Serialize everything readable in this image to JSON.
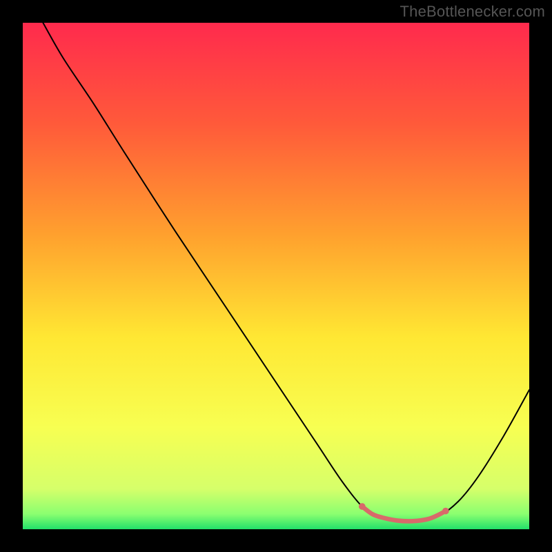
{
  "attribution": "TheBottlenecker.com",
  "chart_data": {
    "type": "line",
    "title": "",
    "xlabel": "",
    "ylabel": "",
    "xlim": [
      0,
      100
    ],
    "ylim": [
      0,
      100
    ],
    "gradient_stops": [
      {
        "offset": 0,
        "color": "#ff2a4d"
      },
      {
        "offset": 20,
        "color": "#ff5a3a"
      },
      {
        "offset": 42,
        "color": "#ffa12e"
      },
      {
        "offset": 62,
        "color": "#ffe733"
      },
      {
        "offset": 80,
        "color": "#f7ff52"
      },
      {
        "offset": 92,
        "color": "#d6ff6a"
      },
      {
        "offset": 97,
        "color": "#8bff70"
      },
      {
        "offset": 100,
        "color": "#22e06a"
      }
    ],
    "series": [
      {
        "name": "bottleneck-curve",
        "color": "#000000",
        "width": 2.0,
        "points": [
          {
            "x": 4.0,
            "y": 100.0
          },
          {
            "x": 8.0,
            "y": 93.0
          },
          {
            "x": 14.0,
            "y": 84.0
          },
          {
            "x": 20.0,
            "y": 74.5
          },
          {
            "x": 30.0,
            "y": 59.0
          },
          {
            "x": 40.0,
            "y": 44.0
          },
          {
            "x": 50.0,
            "y": 29.0
          },
          {
            "x": 58.0,
            "y": 17.0
          },
          {
            "x": 63.0,
            "y": 9.5
          },
          {
            "x": 67.0,
            "y": 4.5
          },
          {
            "x": 70.0,
            "y": 2.5
          },
          {
            "x": 74.0,
            "y": 1.5
          },
          {
            "x": 78.0,
            "y": 1.5
          },
          {
            "x": 82.0,
            "y": 2.5
          },
          {
            "x": 86.0,
            "y": 5.5
          },
          {
            "x": 90.0,
            "y": 10.5
          },
          {
            "x": 95.0,
            "y": 18.5
          },
          {
            "x": 100.0,
            "y": 27.5
          }
        ]
      },
      {
        "name": "optimal-zone-marker",
        "color": "#d86a6a",
        "width": 6.5,
        "points": [
          {
            "x": 67.0,
            "y": 4.5
          },
          {
            "x": 69.0,
            "y": 3.0
          },
          {
            "x": 71.0,
            "y": 2.3
          },
          {
            "x": 74.0,
            "y": 1.7
          },
          {
            "x": 77.0,
            "y": 1.6
          },
          {
            "x": 80.0,
            "y": 2.0
          },
          {
            "x": 82.0,
            "y": 2.8
          },
          {
            "x": 83.5,
            "y": 3.6
          }
        ]
      }
    ]
  }
}
